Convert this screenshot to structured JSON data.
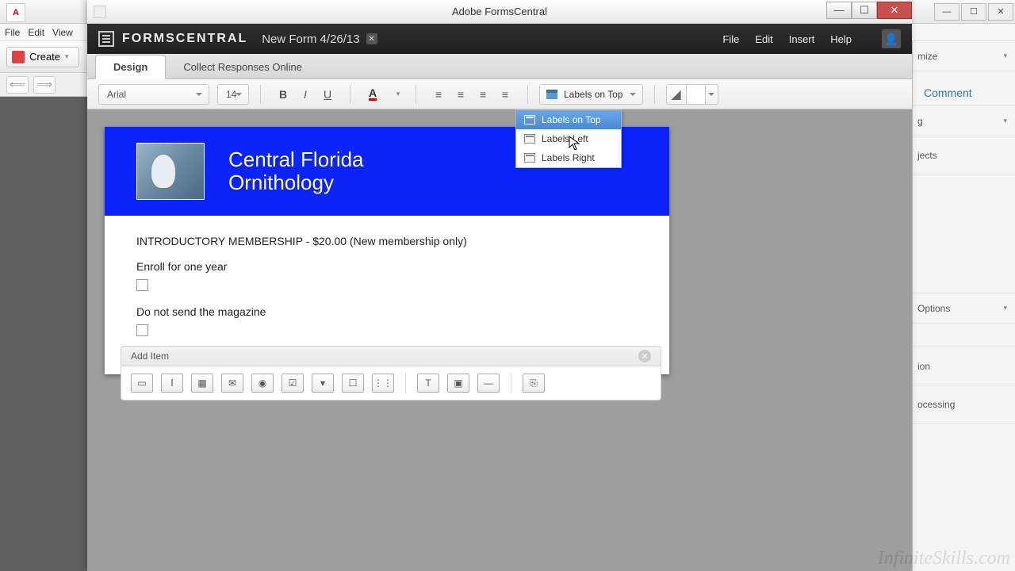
{
  "bg": {
    "menus": {
      "file": "File",
      "edit": "Edit",
      "view": "View"
    },
    "create": "Create",
    "right": {
      "customize": "mize",
      "comment": "Comment",
      "sec1": "g",
      "sec2": "jects",
      "options": "Options",
      "sec3": "ion",
      "sec4": "ocessing"
    }
  },
  "fc": {
    "title": "Adobe FormsCentral",
    "brand": "FORMSCENTRAL",
    "formname": "New Form 4/26/13",
    "menus": {
      "file": "File",
      "edit": "Edit",
      "insert": "Insert",
      "help": "Help"
    },
    "tabs": {
      "design": "Design",
      "collect": "Collect Responses Online"
    },
    "toolbar": {
      "font": "Arial",
      "size": "14",
      "labelpos": "Labels on Top",
      "dd": {
        "top": "Labels on Top",
        "left": "Labels Left",
        "right": "Labels Right"
      }
    }
  },
  "form": {
    "title1": "Central Florida",
    "title2": "Ornithology",
    "q1": "INTRODUCTORY MEMBERSHIP - $20.00 (New membership only)",
    "opt1": "Enroll for one year",
    "opt2": "Do not send the magazine",
    "additem": "Add Item"
  },
  "watermark": "InfiniteSkills.com"
}
